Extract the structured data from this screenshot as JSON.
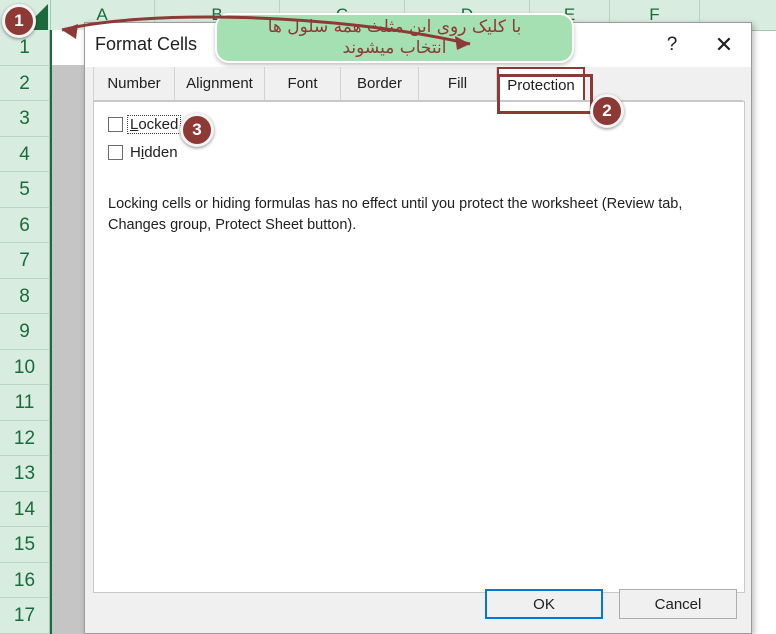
{
  "app": {
    "name": "excel-spreadsheet",
    "column_headers": [
      "A",
      "B",
      "C",
      "D",
      "E",
      "F"
    ],
    "row_headers": [
      "1",
      "2",
      "3",
      "4",
      "5",
      "6",
      "7",
      "8",
      "9",
      "10",
      "11",
      "12",
      "13",
      "14",
      "15",
      "16",
      "17"
    ],
    "select_all_label": "select-all-triangle",
    "active_cell": "A1"
  },
  "dialog": {
    "title": "Format Cells",
    "help_label": "?",
    "close_label": "✕",
    "tabs": [
      {
        "label": "Number",
        "active": false
      },
      {
        "label": "Alignment",
        "active": false
      },
      {
        "label": "Font",
        "active": false
      },
      {
        "label": "Border",
        "active": false
      },
      {
        "label": "Fill",
        "active": false
      },
      {
        "label": "Protection",
        "active": true
      }
    ],
    "protection": {
      "locked": {
        "label": "Locked",
        "accel": "L",
        "checked": false,
        "focused": true
      },
      "hidden": {
        "label": "Hidden",
        "accel": "i",
        "checked": false,
        "focused": false
      },
      "description": "Locking cells or hiding formulas has no effect until you protect the worksheet (Review tab, Changes group, Protect Sheet button)."
    },
    "buttons": {
      "ok": "OK",
      "cancel": "Cancel"
    }
  },
  "annotations": {
    "badges": [
      {
        "number": "1"
      },
      {
        "number": "2"
      },
      {
        "number": "3"
      }
    ],
    "callout": {
      "line1": "با کلیک روی این مثلث همه سلول ها",
      "line2": "انتخاب میشوند"
    }
  },
  "colors": {
    "accent": "#8d3a36",
    "excel_green": "#1a6b3c",
    "header_green": "#d9ece0",
    "callout_green": "#a4e0b2",
    "focus_blue": "#0078d7"
  }
}
